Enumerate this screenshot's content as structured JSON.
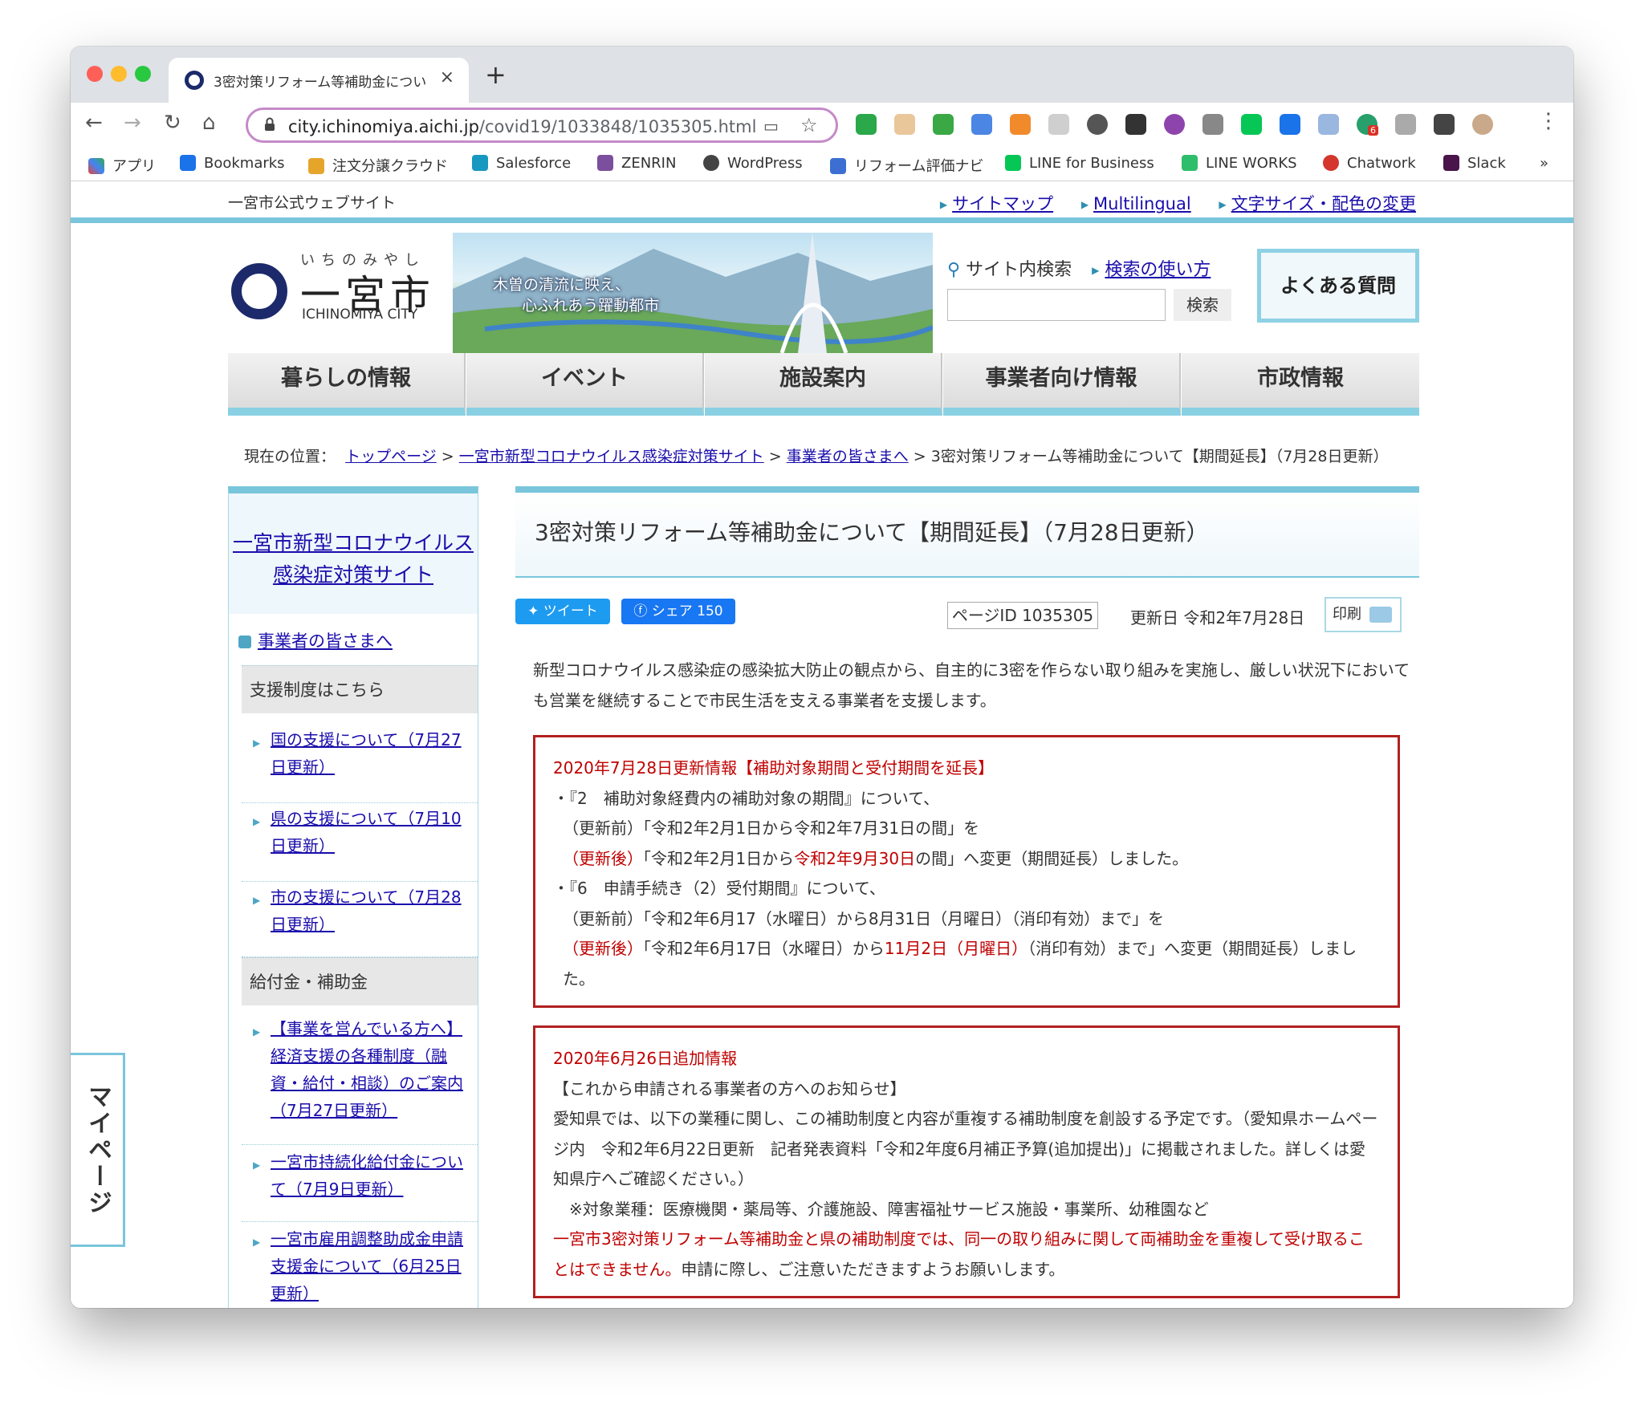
{
  "browser": {
    "tab_title": "3密対策リフォーム等補助金につい",
    "url_host": "city.ichinomiya.aichi.jp",
    "url_path": "/covid19/1033848/1035305.html",
    "bookmarks": [
      "アプリ",
      "Bookmarks",
      "注文分譲クラウド",
      "Salesforce",
      "ZENRIN",
      "WordPress",
      "リフォーム評価ナビ",
      "LINE for Business",
      "LINE WORKS",
      "Chatwork",
      "Slack"
    ],
    "bookmark_overflow": "»",
    "extension_badge": "6"
  },
  "site": {
    "official_label": "一宮市公式ウェブサイト",
    "top_links": [
      "サイトマップ",
      "Multilingual",
      "文字サイズ・配色の変更"
    ],
    "logo_kana": "いちのみやし",
    "logo_name": "一宮市",
    "logo_en": "ICHINOMIYA CITY",
    "banner_line1": "木曽の清流に映え、",
    "banner_line2": "心ふれあう躍動都市",
    "search_label": "サイト内検索",
    "search_help": "検索の使い方",
    "search_button": "検索",
    "faq": "よくある質問",
    "nav": [
      "暮らしの情報",
      "イベント",
      "施設案内",
      "事業者向け情報",
      "市政情報"
    ],
    "mypage": "マイページ"
  },
  "breadcrumb": {
    "label": "現在の位置：",
    "items": [
      "トップページ",
      "一宮市新型コロナウイルス感染症対策サイト",
      "事業者の皆さまへ"
    ],
    "current": "3密対策リフォーム等補助金について【期間延長】（7月28日更新）"
  },
  "sidebar": {
    "title_line1": "一宮市新型コロナウイルス",
    "title_line2": "感染症対策サイト",
    "section": "事業者の皆さまへ",
    "group1": "支援制度はこちら",
    "group1_links": [
      "国の支援について（7月27日更新）",
      "県の支援について（7月10日更新）",
      "市の支援について（7月28日更新）"
    ],
    "group2": "給付金・補助金",
    "group2_links": [
      "【事業を営んでいる方へ】経済支援の各種制度（融資・給付・相談）のご案内（7月27日更新）",
      "一宮市持続化給付金について（7月9日更新）",
      "一宮市雇用調整助成金申請支援金について（6月25日更新）"
    ]
  },
  "main": {
    "title": "3密対策リフォーム等補助金について【期間延長】（7月28日更新）",
    "tweet": "ツイート",
    "share": "シェア 150",
    "page_id": "ページID 1035305",
    "updated": "更新日 令和2年7月28日",
    "print": "印刷",
    "intro": "新型コロナウイルス感染症の感染拡大防止の観点から、自主的に3密を作らない取り組みを実施し、厳しい状況下においても営業を継続することで市民生活を支える事業者を支援します。",
    "box1": {
      "heading": "2020年7月28日更新情報【補助対象期間と受付期間を延長】",
      "item1": "・『2　補助対象経費内の補助対象の期間』について、",
      "item1_before": "（更新前）「令和2年2月1日から令和2年7月31日の間」を",
      "after_label": "（更新後）",
      "item1_after_a": "「令和2年2月1日から",
      "item1_after_red": "令和2年9月30日",
      "item1_after_b": "の間」へ変更（期間延長）しました。",
      "item2": "・『6　申請手続き（2）受付期間』について、",
      "item2_before": "（更新前）「令和2年6月17（水曜日）から8月31日（月曜日）（消印有効）まで」を",
      "item2_after_a": "「令和2年6月17日（水曜日）から",
      "item2_after_red": "11月2日（月曜日）",
      "item2_after_b": "（消印有効）まで」へ変更（期間延長）しました。"
    },
    "box2": {
      "heading": "2020年6月26日追加情報",
      "subheading": "【これから申請される事業者の方へのお知らせ】",
      "body": "愛知県では、以下の業種に関し、この補助制度と内容が重複する補助制度を創設する予定です。（愛知県ホームページ内　令和2年6月22日更新　記者発表資料「令和2年度6月補正予算(追加提出)」に掲載されました。詳しくは愛知県庁へご確認ください。）",
      "industries": "※対象業種：医療機関・薬局等、介護施設、障害福祉サービス施設・事業所、幼稚園など",
      "warning_red": "一宮市3密対策リフォーム等補助金と県の補助制度では、同一の取り組みに関して両補助金を重複して受け取ることはできません。",
      "warning_tail": "申請に際し、ご注意いただきますようお願いします。"
    }
  },
  "colors": {
    "accent": "#79c6dc",
    "link": "#1a0dab",
    "notice_red": "#b22020"
  }
}
